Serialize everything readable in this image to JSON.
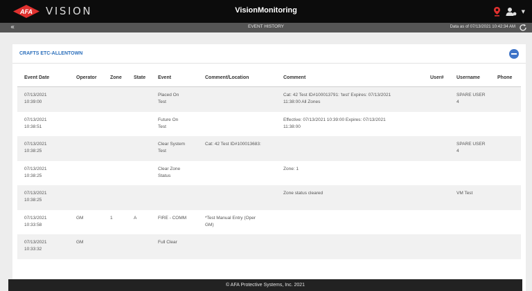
{
  "header": {
    "logo_badge_text": "AFA",
    "logo_word": "VISION",
    "app_title": "VisionMonitoring"
  },
  "subbar": {
    "title": "EVENT HISTORY",
    "data_as_of": "Data as of 07/13/2021 10:42:34 AM"
  },
  "panel": {
    "title": "CRAFTS ETC-ALLENTOWN"
  },
  "table": {
    "columns": [
      "Event Date",
      "Operator",
      "Zone",
      "State",
      "Event",
      "Comment/Location",
      "Comment",
      "User#",
      "Username",
      "Phone"
    ],
    "rows": [
      {
        "date": "07/13/2021\n10:39:00",
        "operator": "",
        "zone": "",
        "state": "",
        "event": "Placed On\nTest",
        "comment_location": "",
        "comment": "Cat: 42 Test ID#100013791: 'test' Expires: 07/13/2021\n11:38:00 All Zones",
        "user_num": "",
        "username": "SPARE USER\n4",
        "phone": ""
      },
      {
        "date": "07/13/2021\n10:38:51",
        "operator": "",
        "zone": "",
        "state": "",
        "event": "Future On\nTest",
        "comment_location": "",
        "comment": "Effective: 07/13/2021 10:39:00 Expires: 07/13/2021\n11:38:00",
        "user_num": "",
        "username": "",
        "phone": ""
      },
      {
        "date": "07/13/2021\n10:38:25",
        "operator": "",
        "zone": "",
        "state": "",
        "event": "Clear System\nTest",
        "comment_location": "Cat: 42 Test ID#100013683:",
        "comment": "",
        "user_num": "",
        "username": "SPARE USER\n4",
        "phone": ""
      },
      {
        "date": "07/13/2021\n10:38:25",
        "operator": "",
        "zone": "",
        "state": "",
        "event": "Clear Zone\nStatus",
        "comment_location": "",
        "comment": "Zone: 1",
        "user_num": "",
        "username": "",
        "phone": ""
      },
      {
        "date": "07/13/2021\n10:38:25",
        "operator": "",
        "zone": "",
        "state": "",
        "event": "",
        "comment_location": "",
        "comment": "Zone status cleared",
        "user_num": "",
        "username": "VM Test",
        "phone": ""
      },
      {
        "date": "07/13/2021\n10:33:58",
        "operator": "GM",
        "zone": "1",
        "state": "A",
        "event": "FIRE - COMM",
        "comment_location": "*Test  Manual Entry (Oper\nGM)",
        "comment": "",
        "user_num": "",
        "username": "",
        "phone": ""
      },
      {
        "date": "07/13/2021\n10:33:32",
        "operator": "GM",
        "zone": "",
        "state": "",
        "event": "Full Clear",
        "comment_location": "",
        "comment": "",
        "user_num": "",
        "username": "",
        "phone": ""
      }
    ]
  },
  "footer": {
    "text": "© AFA Protective Systems, Inc. 2021"
  },
  "colors": {
    "accent": "#2a6ebb",
    "brand_red": "#e0312f",
    "topbar": "#0c0c0c",
    "subbar": "#555555"
  },
  "icons": [
    "afa-logo-icon",
    "alert-icon",
    "user-menu-icon",
    "caret-down-icon",
    "back-icon",
    "refresh-icon",
    "collapse-icon"
  ]
}
